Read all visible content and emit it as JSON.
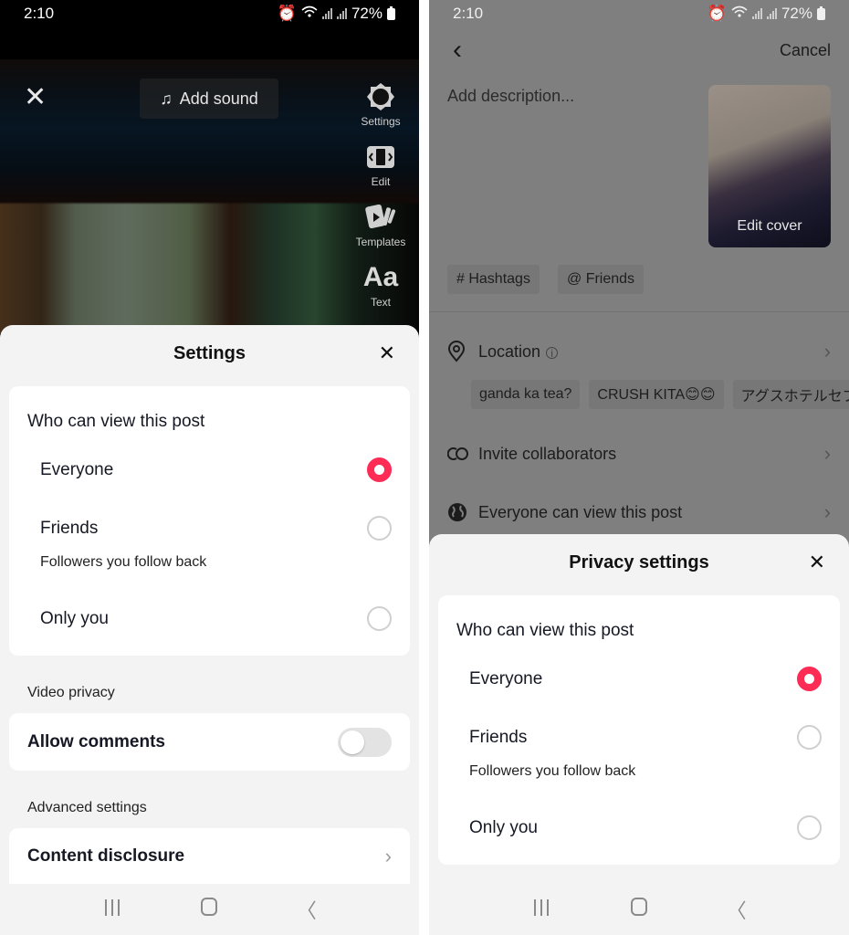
{
  "left": {
    "status_bar": {
      "time": "2:10",
      "battery": "72%"
    },
    "editor": {
      "add_sound_label": "Add sound",
      "tools": [
        {
          "label": "Settings",
          "icon": "gear-icon"
        },
        {
          "label": "Edit",
          "icon": "edit-clip-icon"
        },
        {
          "label": "Templates",
          "icon": "templates-icon"
        },
        {
          "label": "Text",
          "icon": "text-icon",
          "glyph": "Aa"
        }
      ]
    },
    "sheet": {
      "title": "Settings",
      "who_can_view": {
        "title": "Who can view this post",
        "options": [
          {
            "label": "Everyone",
            "selected": true
          },
          {
            "label": "Friends",
            "sublabel": "Followers you follow back",
            "selected": false
          },
          {
            "label": "Only you",
            "selected": false
          }
        ]
      },
      "video_privacy_label": "Video privacy",
      "allow_comments": {
        "label": "Allow comments",
        "enabled": false
      },
      "advanced_settings_label": "Advanced settings",
      "content_disclosure_label": "Content disclosure"
    }
  },
  "right": {
    "status_bar": {
      "time": "2:10",
      "battery": "72%"
    },
    "header": {
      "cancel_label": "Cancel"
    },
    "description_placeholder": "Add description...",
    "cover_label": "Edit cover",
    "chips": [
      {
        "label": "# Hashtags"
      },
      {
        "label": "@ Friends"
      }
    ],
    "location": {
      "label": "Location",
      "suggestions": [
        "ganda ka tea?",
        "CRUSH KITA😊😊",
        "アグスホテルセブ"
      ]
    },
    "invite_collaborators_label": "Invite collaborators",
    "visibility_label": "Everyone can view this post",
    "sheet": {
      "title": "Privacy settings",
      "who_can_view": {
        "title": "Who can view this post",
        "options": [
          {
            "label": "Everyone",
            "selected": true
          },
          {
            "label": "Friends",
            "sublabel": "Followers you follow back",
            "selected": false
          },
          {
            "label": "Only you",
            "selected": false
          }
        ]
      }
    }
  },
  "colors": {
    "accent": "#fe2c55",
    "sheet_bg": "#f3f3f3",
    "card_bg": "#ffffff",
    "scrim": "#7f7f7f"
  }
}
